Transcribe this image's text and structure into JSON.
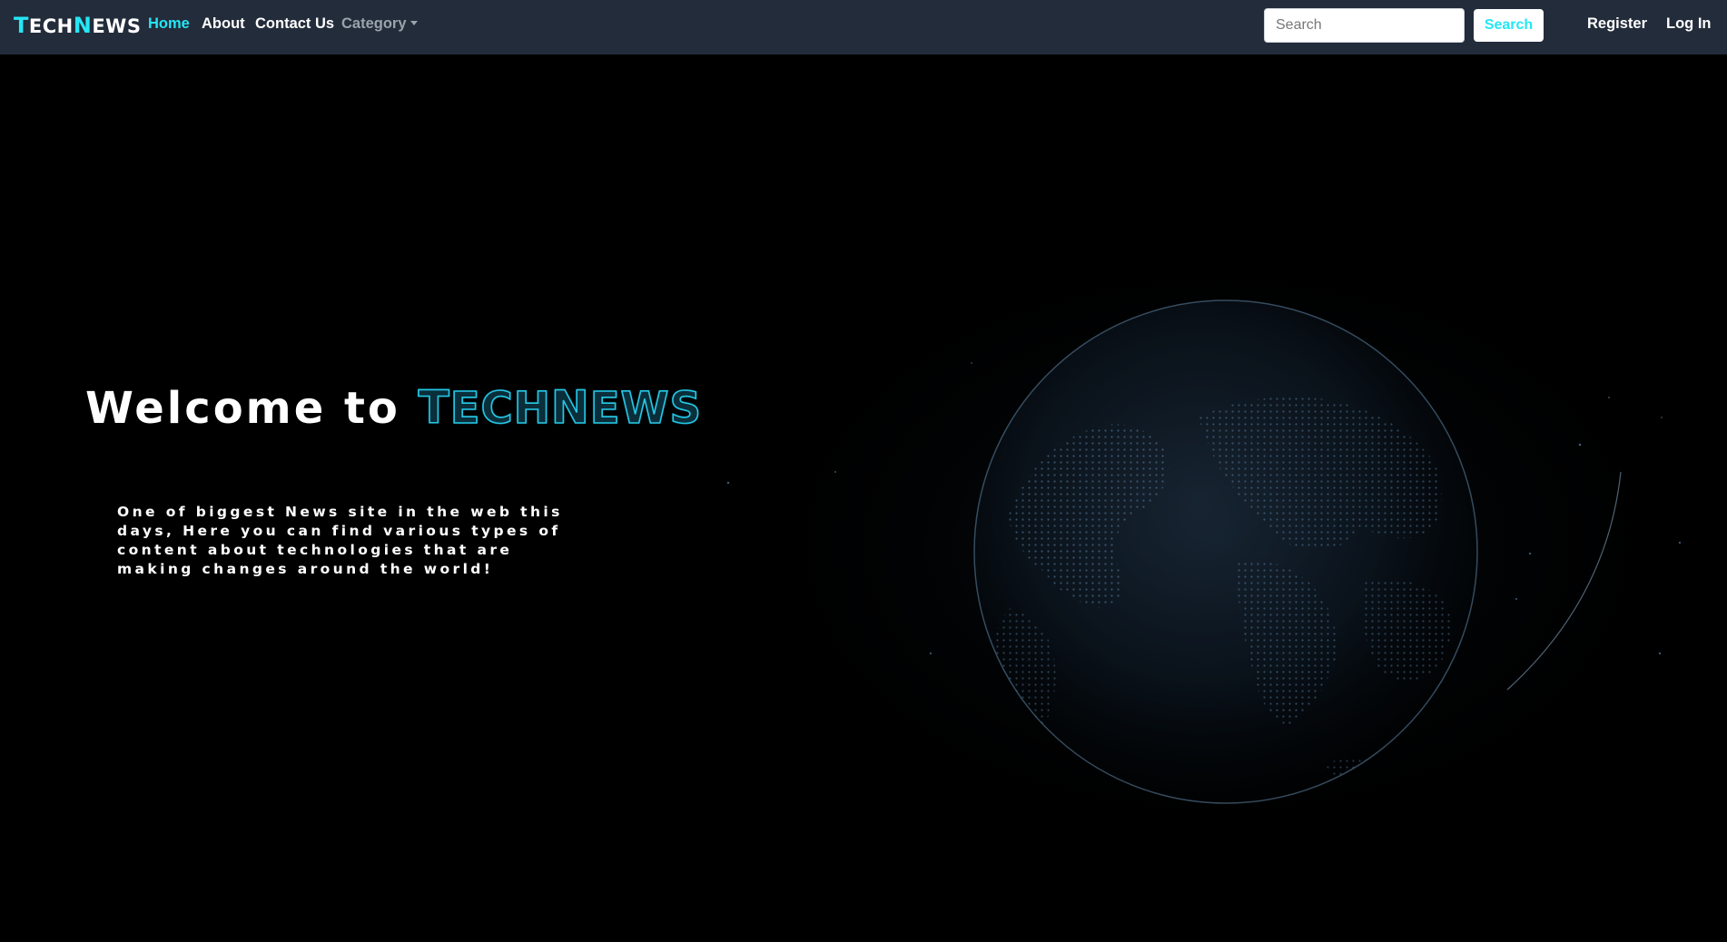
{
  "navbar": {
    "brand": {
      "t": "T",
      "ech": "ECH",
      "n": "N",
      "ews": "EWS"
    },
    "links": {
      "home": "Home",
      "about": "About",
      "contact": "Contact Us",
      "category": "Category"
    },
    "search": {
      "placeholder": "Search",
      "button_label": "Search"
    },
    "auth": {
      "register": "Register",
      "login": "Log In"
    }
  },
  "hero": {
    "welcome_prefix": "Welcome to",
    "brand": {
      "t": "T",
      "ech": "ECH",
      "n": "N",
      "ews": "EWS"
    },
    "tagline_lines": [
      "One of biggest News site in the web this",
      "days, Here you can find various types of",
      "content about technologies that are",
      "making changes around the world!"
    ]
  },
  "colors": {
    "navbar_bg": "#232c3a",
    "accent": "#25e6f5",
    "muted": "#9aa2ac",
    "page_bg": "#000000"
  }
}
